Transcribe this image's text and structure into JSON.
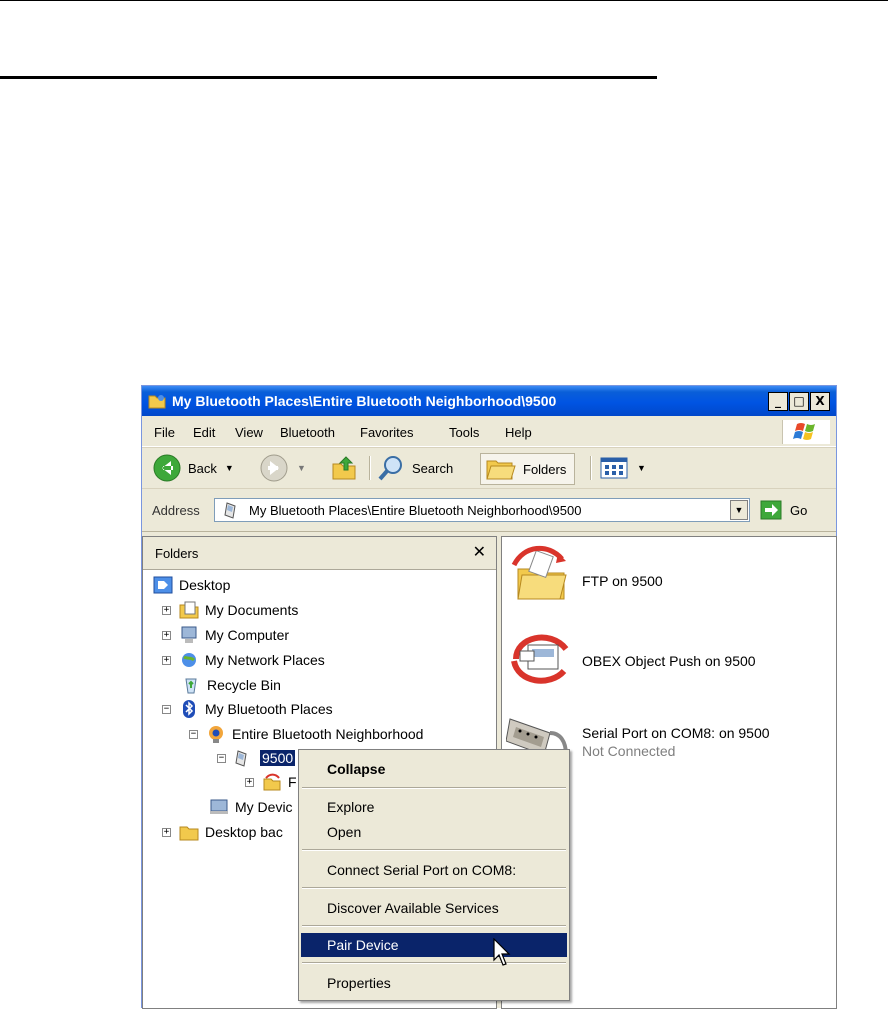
{
  "window": {
    "title": "My Bluetooth Places\\Entire Bluetooth Neighborhood\\9500",
    "controls": {
      "minimize": "_",
      "maximize": "□",
      "close": "X"
    }
  },
  "menubar": {
    "items": [
      "File",
      "Edit",
      "View",
      "Bluetooth",
      "Favorites",
      "Tools",
      "Help"
    ]
  },
  "toolbar": {
    "back_label": "Back",
    "search_label": "Search",
    "folders_label": "Folders"
  },
  "address_bar": {
    "label": "Address",
    "value": "My Bluetooth Places\\Entire Bluetooth Neighborhood\\9500",
    "go_label": "Go"
  },
  "folders_pane": {
    "header": "Folders",
    "close": "✕",
    "tree": [
      {
        "label": "Desktop",
        "icon": "desktop-icon"
      },
      {
        "label": "My Documents",
        "icon": "my-documents-icon"
      },
      {
        "label": "My Computer",
        "icon": "my-computer-icon"
      },
      {
        "label": "My Network Places",
        "icon": "network-places-icon"
      },
      {
        "label": "Recycle Bin",
        "icon": "recycle-bin-icon"
      },
      {
        "label": "My Bluetooth Places",
        "icon": "bluetooth-icon"
      },
      {
        "label": "Entire Bluetooth Neighborhood",
        "icon": "neighborhood-icon"
      },
      {
        "label": "9500",
        "icon": "phone-device-icon"
      },
      {
        "label": "F",
        "icon": "ftp-folder-icon"
      },
      {
        "label": "My Devic",
        "icon": "my-device-icon"
      },
      {
        "label": "Desktop bac",
        "icon": "folder-icon"
      }
    ]
  },
  "services": [
    {
      "name": "FTP on 9500",
      "status": ""
    },
    {
      "name": "OBEX Object Push on 9500",
      "status": ""
    },
    {
      "name": "Serial Port on COM8: on 9500",
      "status": "Not Connected"
    }
  ],
  "context_menu": {
    "items": [
      {
        "label": "Collapse"
      },
      {
        "label": "Explore"
      },
      {
        "label": "Open"
      },
      {
        "label": "Connect Serial Port on COM8:"
      },
      {
        "label": "Discover Available Services"
      },
      {
        "label": "Pair Device"
      },
      {
        "label": "Properties"
      }
    ]
  }
}
